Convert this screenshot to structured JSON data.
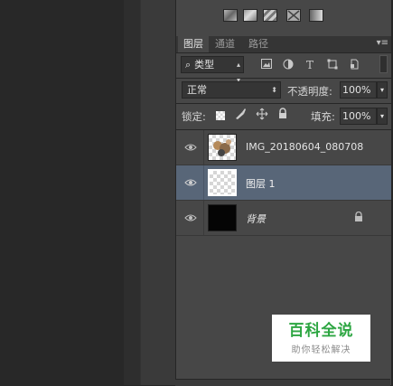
{
  "tabs": [
    {
      "label": "图层"
    },
    {
      "label": "通道"
    },
    {
      "label": "路径"
    }
  ],
  "panel_menu": "▾≡",
  "filter": {
    "label": "类型",
    "search_glyph": "⌕"
  },
  "blend": {
    "mode": "正常",
    "opacity_label": "不透明度:",
    "opacity_value": "100%"
  },
  "lock": {
    "label": "锁定:",
    "fill_label": "填充:",
    "fill_value": "100%"
  },
  "layers": [
    {
      "name": "IMG_20180604_080708"
    },
    {
      "name": "图层 1"
    },
    {
      "name": "背景"
    }
  ],
  "watermark": {
    "title": "百科全说",
    "subtitle": "助你轻松解决"
  },
  "icons": {
    "eye": "eye-icon",
    "lock": "lock-icon",
    "dropdown": "chevron-down-icon"
  },
  "colors": {
    "selected_layer": "#586678",
    "panel": "#474747",
    "accent": "#2da642"
  }
}
